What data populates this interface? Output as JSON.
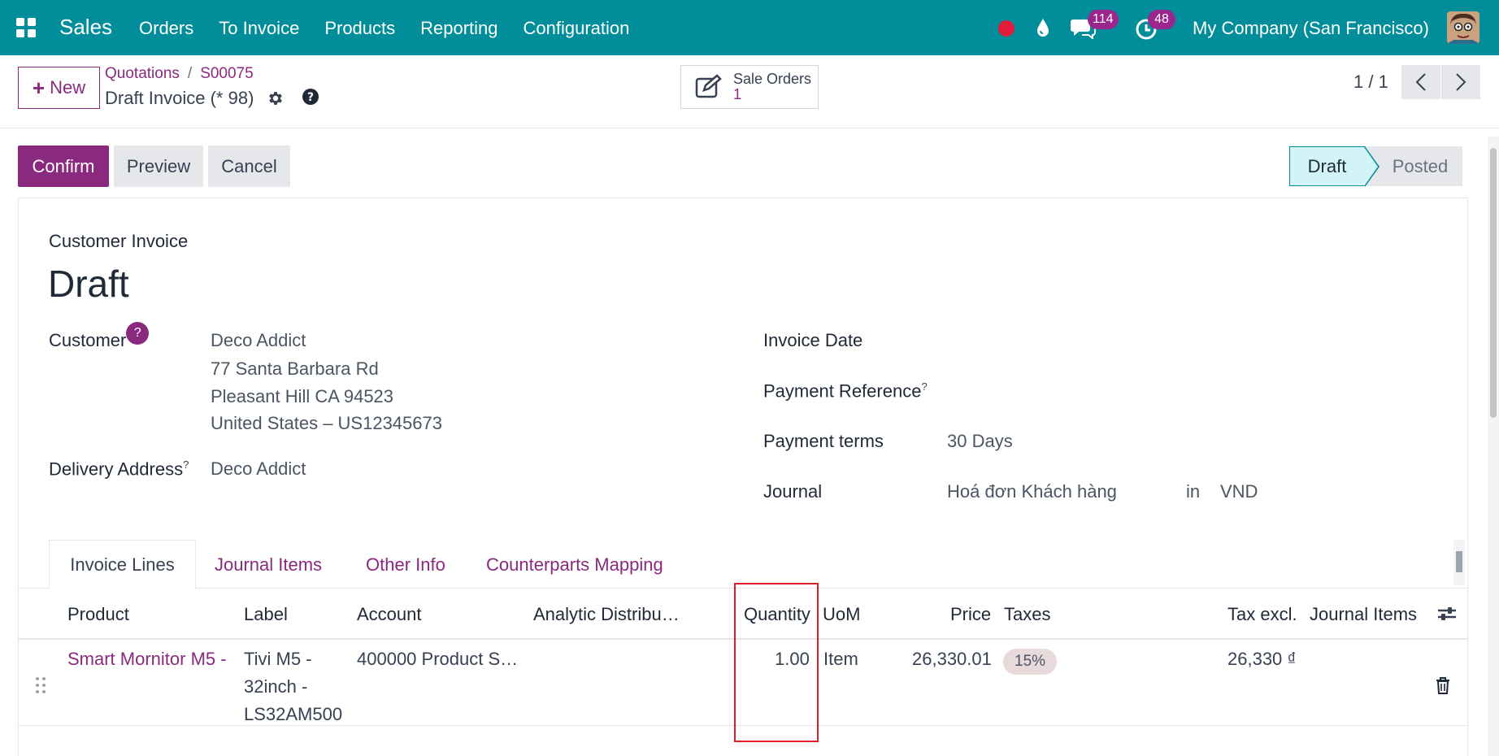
{
  "nav": {
    "app_name": "Sales",
    "menu": [
      "Orders",
      "To Invoice",
      "Products",
      "Reporting",
      "Configuration"
    ],
    "messages_count": "114",
    "activities_count": "48",
    "company": "My Company (San Francisco)",
    "colors": {
      "navbar": "#018d99",
      "accent": "#8a2a7f",
      "recording": "#e21b3c"
    }
  },
  "control": {
    "new_button": "New",
    "breadcrumb": [
      "Quotations",
      "S00075"
    ],
    "breadcrumb_separator": "/",
    "record_title": "Draft Invoice (* 98)",
    "smart_button": {
      "label": "Sale Orders",
      "value": "1"
    },
    "pager": "1 / 1"
  },
  "actions": {
    "confirm": "Confirm",
    "preview": "Preview",
    "cancel": "Cancel",
    "status": [
      "Draft",
      "Posted"
    ],
    "current_status": "Draft"
  },
  "invoice": {
    "type": "Customer Invoice",
    "name": "Draft",
    "customer_label": "Customer",
    "customer_help": "?",
    "customer_lines": [
      "Deco Addict",
      "77 Santa Barbara Rd",
      "Pleasant Hill CA 94523",
      "United States – US12345673"
    ],
    "delivery_label": "Delivery Address",
    "delivery_value": "Deco Addict",
    "invoice_date_label": "Invoice Date",
    "payment_ref_label": "Payment Reference",
    "payment_terms_label": "Payment terms",
    "payment_terms_value": "30 Days",
    "journal_label": "Journal",
    "journal_value": "Hoá đơn Khách hàng",
    "journal_in": "in",
    "journal_currency": "VND",
    "help_marker": "?"
  },
  "tabs": [
    "Invoice Lines",
    "Journal Items",
    "Other Info",
    "Counterparts Mapping"
  ],
  "lines": {
    "columns": [
      "Product",
      "Label",
      "Account",
      "Analytic Distribu…",
      "Quantity",
      "UoM",
      "Price",
      "Taxes",
      "Tax excl.",
      "Journal Items"
    ],
    "rows": [
      {
        "product": "Smart Mornitor M5 - :",
        "label_lines": [
          "Tivi M5 -",
          "32inch -",
          "LS32AM500"
        ],
        "account": "400000 Product S…",
        "quantity": "1.00",
        "uom": "Item",
        "price": "26,330.01",
        "tax": "15%",
        "tax_excl": "26,330 ₫"
      }
    ]
  }
}
